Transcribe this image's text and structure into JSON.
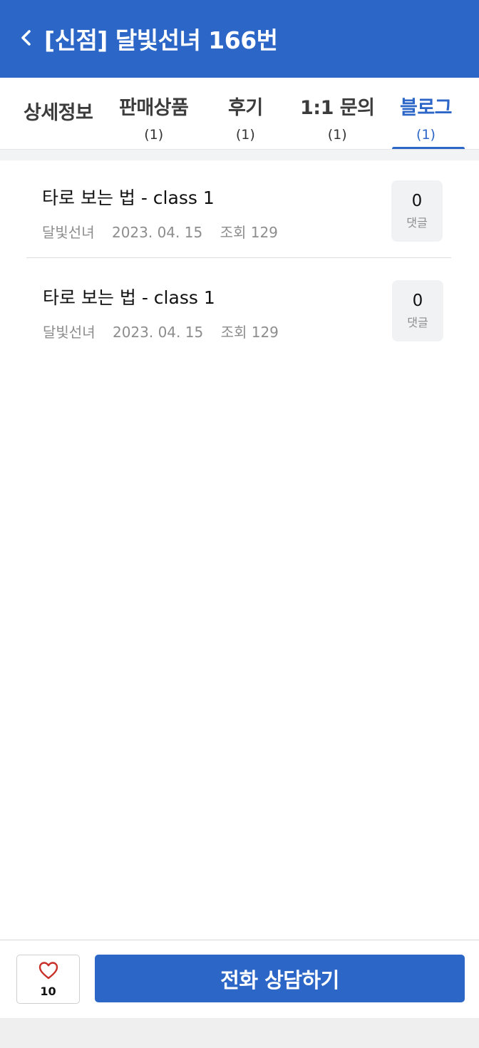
{
  "header": {
    "title": "[신점] 달빛선녀 166번",
    "back_icon": "chevron-left-icon"
  },
  "tabs": [
    {
      "label": "상세정보",
      "count": ""
    },
    {
      "label": "판매상품",
      "count": "(1)"
    },
    {
      "label": "후기",
      "count": "(1)"
    },
    {
      "label": "1:1 문의",
      "count": "(1)"
    },
    {
      "label": "블로그",
      "count": "(1)",
      "active": true
    }
  ],
  "posts": [
    {
      "title": "타로 보는 법 - class 1",
      "author": "달빛선녀",
      "date": "2023. 04. 15",
      "views": "조회 129",
      "comments": "0",
      "comment_label": "댓글"
    },
    {
      "title": "타로 보는 법 - class 1",
      "author": "달빛선녀",
      "date": "2023. 04. 15",
      "views": "조회 129",
      "comments": "0",
      "comment_label": "댓글"
    }
  ],
  "bottom": {
    "like_icon": "heart-icon",
    "like_count": "10",
    "call_label": "전화 상담하기"
  },
  "colors": {
    "primary": "#2c67c8",
    "heart": "#c8312a"
  }
}
